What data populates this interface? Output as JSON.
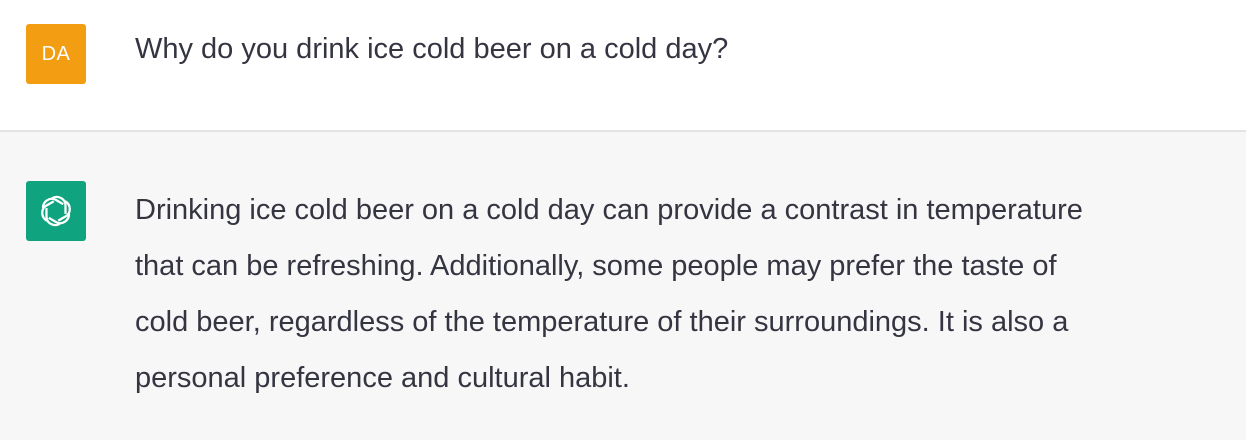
{
  "user_message": {
    "avatar_initials": "DA",
    "avatar_color": "#f29d12",
    "text": "Why do you drink ice cold beer on a cold day?"
  },
  "assistant_message": {
    "avatar_icon": "openai-logo-icon",
    "avatar_color": "#10a37f",
    "lines": [
      "Drinking ice cold beer on a cold day can provide a contrast in temperature",
      "that can be refreshing. Additionally, some people may prefer the taste of",
      "cold beer, regardless of the temperature of their surroundings. It is also a",
      "personal preference and cultural habit."
    ]
  },
  "colors": {
    "user_row_bg": "#ffffff",
    "assistant_row_bg": "#f7f7f8",
    "divider": "#e3e3e6",
    "text": "#343541"
  }
}
